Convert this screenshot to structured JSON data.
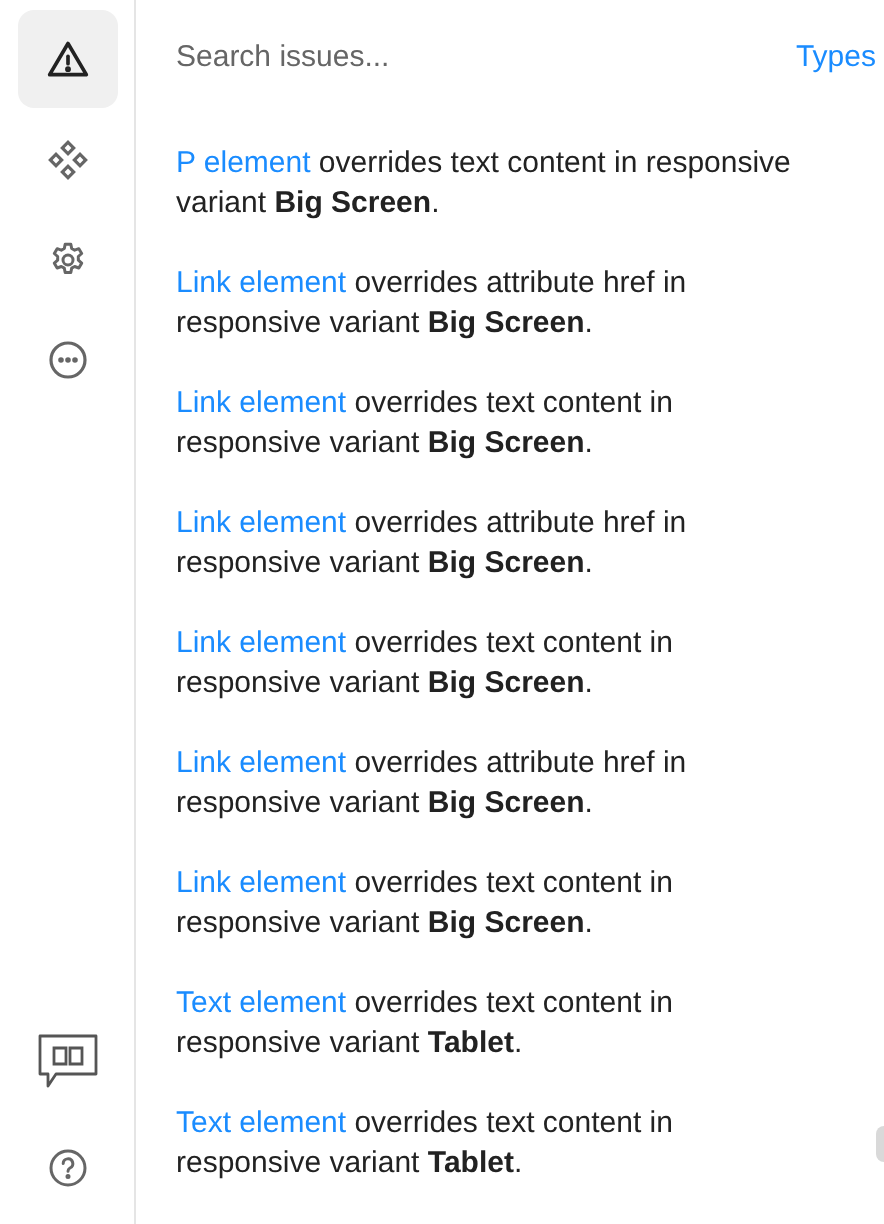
{
  "sidebar": {
    "items": [
      {
        "kind": "warning",
        "selected": true
      },
      {
        "kind": "components",
        "selected": false
      },
      {
        "kind": "settings",
        "selected": false
      },
      {
        "kind": "more",
        "selected": false
      }
    ],
    "bottom_items": [
      {
        "kind": "docs"
      },
      {
        "kind": "help"
      }
    ]
  },
  "search": {
    "placeholder": "Search issues...",
    "types_link": "Types"
  },
  "issues": [
    {
      "element": "P element",
      "text": " overrides text content in responsive variant **Big Screen**."
    },
    {
      "element": "Link element",
      "text": " overrides attribute href in responsive variant **Big Screen**."
    },
    {
      "element": "Link element",
      "text": " overrides text content in responsive variant **Big Screen**."
    },
    {
      "element": "Link element",
      "text": " overrides attribute href in responsive variant **Big Screen**."
    },
    {
      "element": "Link element",
      "text": " overrides text content in responsive variant **Big Screen**."
    },
    {
      "element": "Link element",
      "text": " overrides attribute href in responsive variant **Big Screen**."
    },
    {
      "element": "Link element",
      "text": " overrides text content in responsive variant **Big Screen**."
    },
    {
      "element": "Text element",
      "text": " overrides text content in responsive variant **Tablet**."
    },
    {
      "element": "Text element",
      "text": " overrides text content in responsive variant **Tablet**."
    }
  ]
}
